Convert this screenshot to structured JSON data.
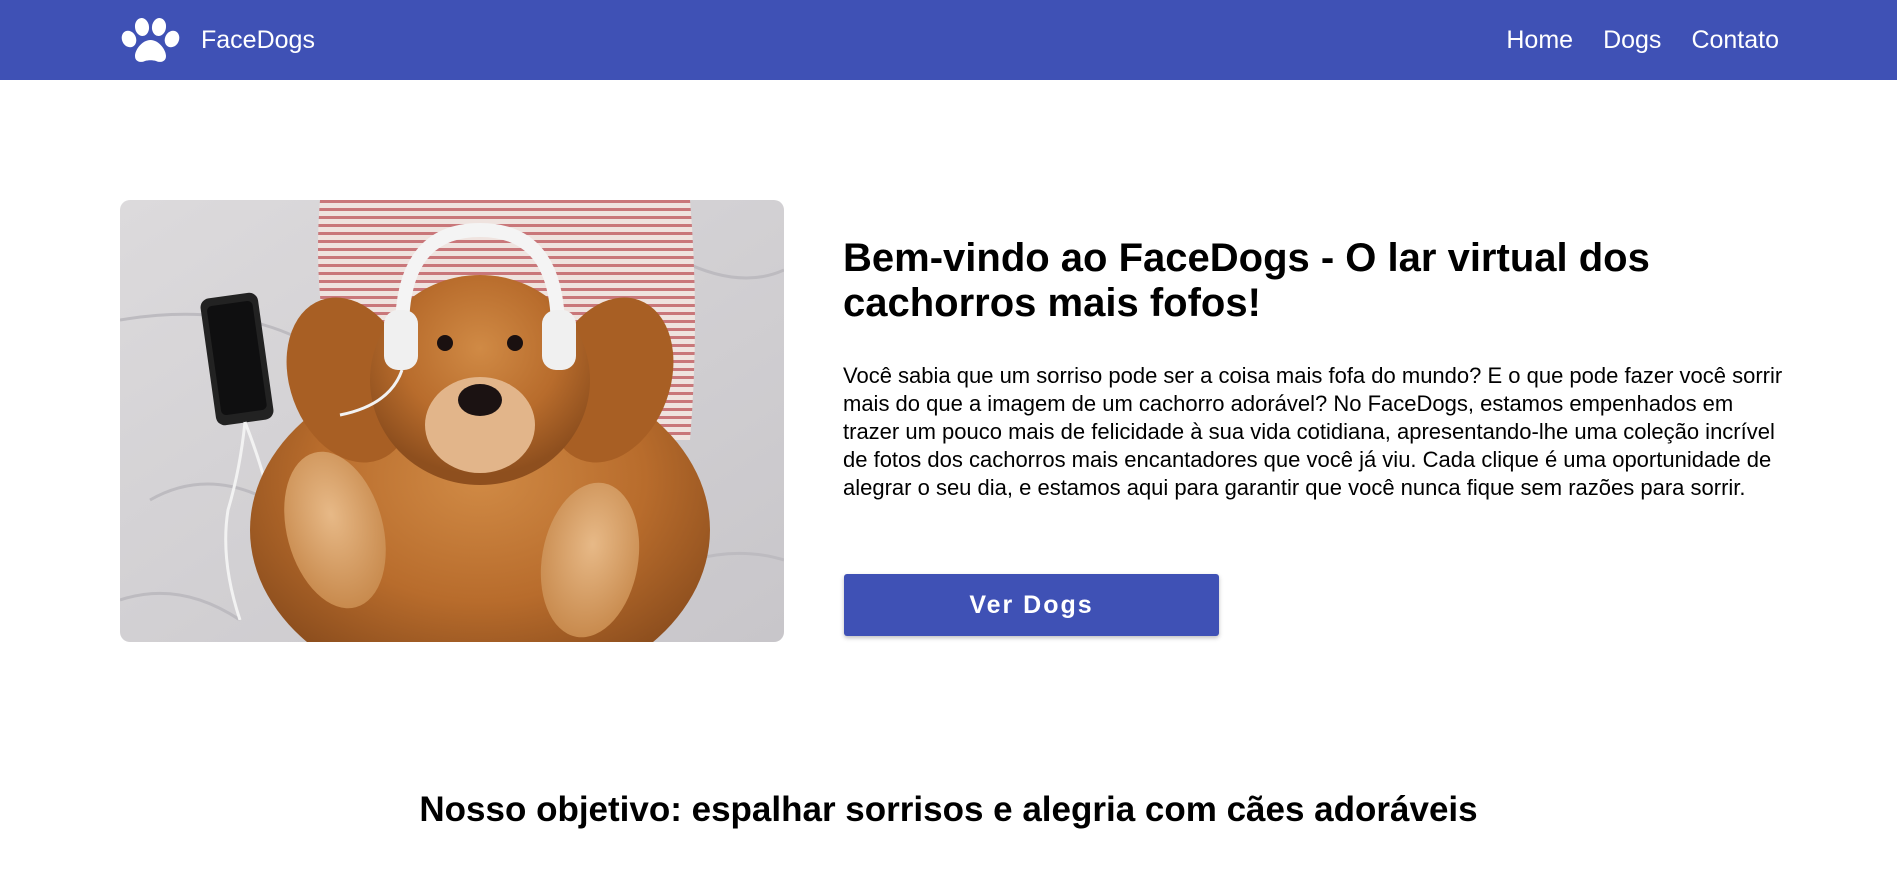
{
  "colors": {
    "primary": "#3f51b5",
    "text": "#000000",
    "nav_text": "#ffffff"
  },
  "nav": {
    "logo_icon": "paw-icon",
    "brand": "FaceDogs",
    "links": [
      "Home",
      "Dogs",
      "Contato"
    ]
  },
  "hero": {
    "image_icon": "golden-retriever-headphones-photo",
    "title": "Bem-vindo ao FaceDogs - O lar virtual dos cachorros mais fofos!",
    "text": "Você sabia que um sorriso pode ser a coisa mais fofa do mundo? E o que pode fazer você sorrir mais do que a imagem de um cachorro adorável? No FaceDogs, estamos empenhados em trazer um pouco mais de felicidade à sua vida cotidiana, apresentando-lhe uma coleção incrível de fotos dos cachorros mais encantadores que você já viu. Cada clique é uma oportunidade de alegrar o seu dia, e estamos aqui para garantir que você nunca fique sem razões para sorrir.",
    "button": "Ver Dogs"
  },
  "mission": {
    "title": "Nosso objetivo: espalhar sorrisos e alegria com cães adoráveis"
  }
}
